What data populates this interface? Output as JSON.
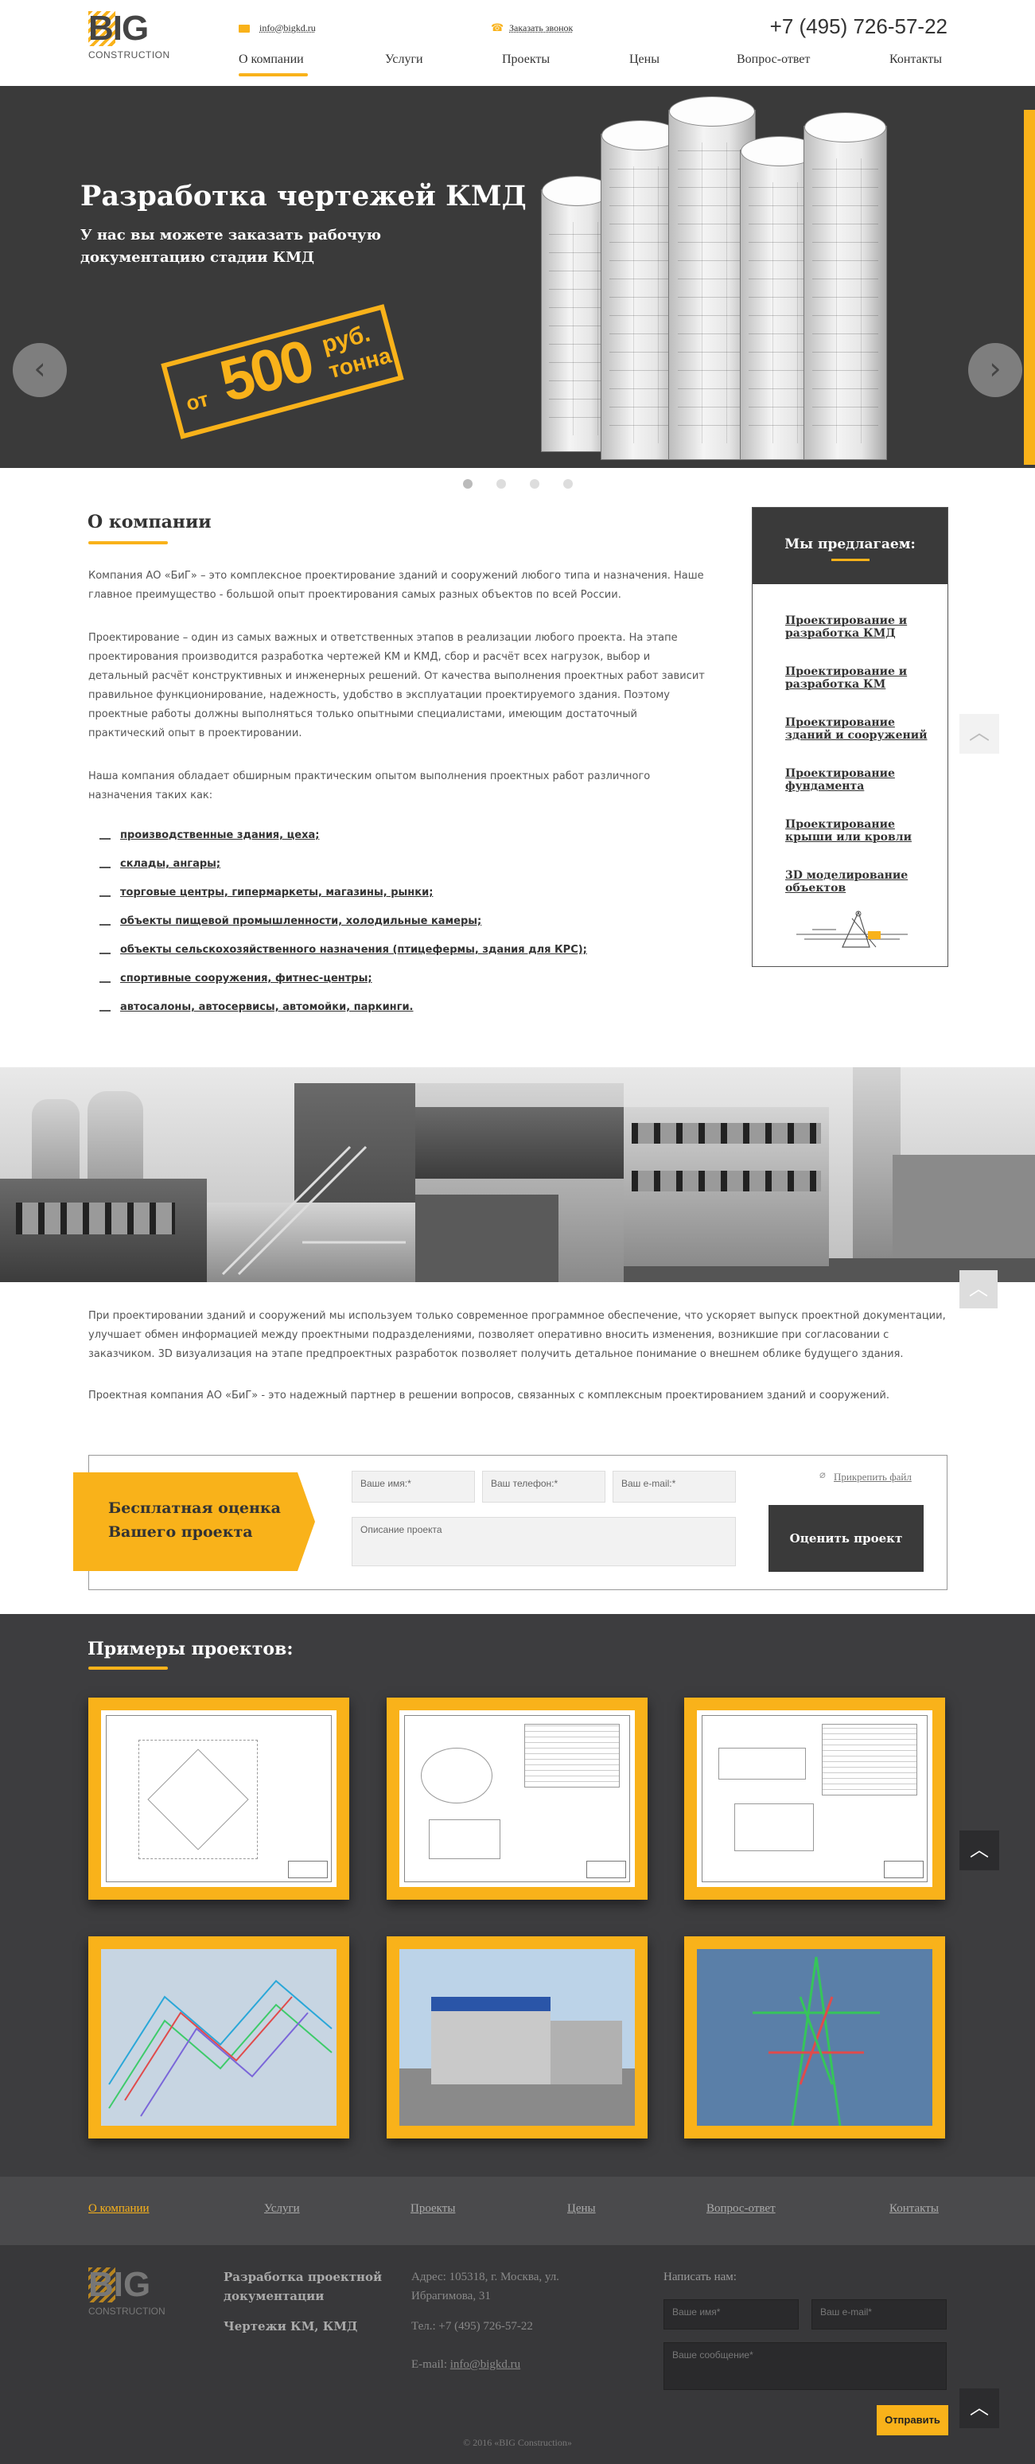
{
  "header": {
    "logo_text": "BIG",
    "logo_sub": "CONSTRUCTION",
    "email": "info@bigkd.ru",
    "callback": "Заказать звонок",
    "phone": "+7 (495) 726-57-22",
    "nav": [
      "О компании",
      "Услуги",
      "Проекты",
      "Цены",
      "Вопрос-ответ",
      "Контакты"
    ],
    "active_nav": "О компании"
  },
  "hero": {
    "title": "Разработка чертежей КМД",
    "subtitle": "У нас вы можете заказать рабочую документацию стадии КМД",
    "stamp_from": "от",
    "stamp_price": "500",
    "stamp_currency": "руб.",
    "stamp_unit": "тонна",
    "prev_icon": "chevron-left-icon",
    "next_icon": "chevron-right-icon",
    "slides_count": 4,
    "active_slide": 1
  },
  "about": {
    "title": "О компании",
    "p1": "Компания АО «БиГ» – это комплексное проектирование зданий и сооружений любого типа и назначения. Наше главное преимущество - большой опыт проектирования самых разных объектов по всей России.",
    "p2": "Проектирование – один из самых важных и ответственных этапов в реализации любого проекта. На этапе проектирования производится разработка чертежей КМ и КМД, сбор и расчёт всех нагрузок, выбор и детальный расчёт конструктивных и инженерных решений. От качества выполнения проектных работ зависит правильное функционирование, надежность, удобство в эксплуатации проектируемого здания. Поэтому проектные работы должны выполняться только опытными специалистами, имеющим достаточный практический опыт в проектировании.",
    "p3": "Наша компания обладает обширным практическим опытом выполнения проектных работ различного назначения таких как:",
    "list": [
      "производственные здания, цеха;",
      "склады, ангары;",
      "торговые центры, гипермаркеты, магазины, рынки;",
      "объекты пищевой промышленности, холодильные камеры;",
      "объекты сельскохозяйственного назначения (птицефермы, здания для КРС);",
      "спортивные сооружения, фитнес-центры;",
      "автосалоны, автосервисы, автомойки, паркинги."
    ]
  },
  "offer": {
    "title": "Мы предлагаем:",
    "items": [
      "Проектирование и разработка КМД",
      "Проектирование и разработка КМ",
      "Проектирование зданий и сооружений",
      "Проектирование фундамента",
      "Проектирование крыши или кровли",
      "3D моделирование объектов"
    ]
  },
  "after": {
    "p1": "При проектировании зданий и сооружений мы используем только современное программное обеспечение, что ускоряет выпуск проектной документации, улучшает обмен информацией между проектными подразделениями, позволяет оперативно вносить изменения, возникшие при согласовании с заказчиком. 3D визуализация на этапе предпроектных разработок позволяет получить детальное понимание о внешнем облике будущего здания.",
    "p2": "Проектная компания АО «БиГ» - это надежный партнер в решении вопросов, связанных с комплексным проектированием зданий и сооружений."
  },
  "form": {
    "title": "Бесплатная оценка Вашего проекта",
    "name_placeholder": "Ваше имя:*",
    "phone_placeholder": "Ваш телефон:*",
    "email_placeholder": "Ваш e-mail:*",
    "desc_placeholder": "Описание проекта",
    "attach": "Прикрепить файл",
    "submit": "Оценить проект"
  },
  "projects": {
    "title": "Примеры проектов:"
  },
  "footer_nav": [
    "О компании",
    "Услуги",
    "Проекты",
    "Цены",
    "Вопрос-ответ",
    "Контакты"
  ],
  "footer": {
    "logo_text": "BIG",
    "logo_sub": "CONSTRUCTION",
    "col1_line1": "Разработка проектной документации",
    "col1_line2": "Чертежи КМ, КМД",
    "address": "Адрес: 105318, г. Москва, ул. Ибрагимова, 31",
    "tel": "Тел.: +7 (495) 726-57-22",
    "email_label": "E-mail:",
    "email": "info@bigkd.ru",
    "write_title": "Написать нам:",
    "name_placeholder": "Ваше имя*",
    "email_placeholder": "Ваш e-mail*",
    "message_placeholder": "Ваше сообщение*",
    "send": "Отправить",
    "copyright": "© 2016 «BIG Construction»"
  },
  "colors": {
    "accent": "#f9b21a",
    "dark": "#3a3a3a"
  }
}
